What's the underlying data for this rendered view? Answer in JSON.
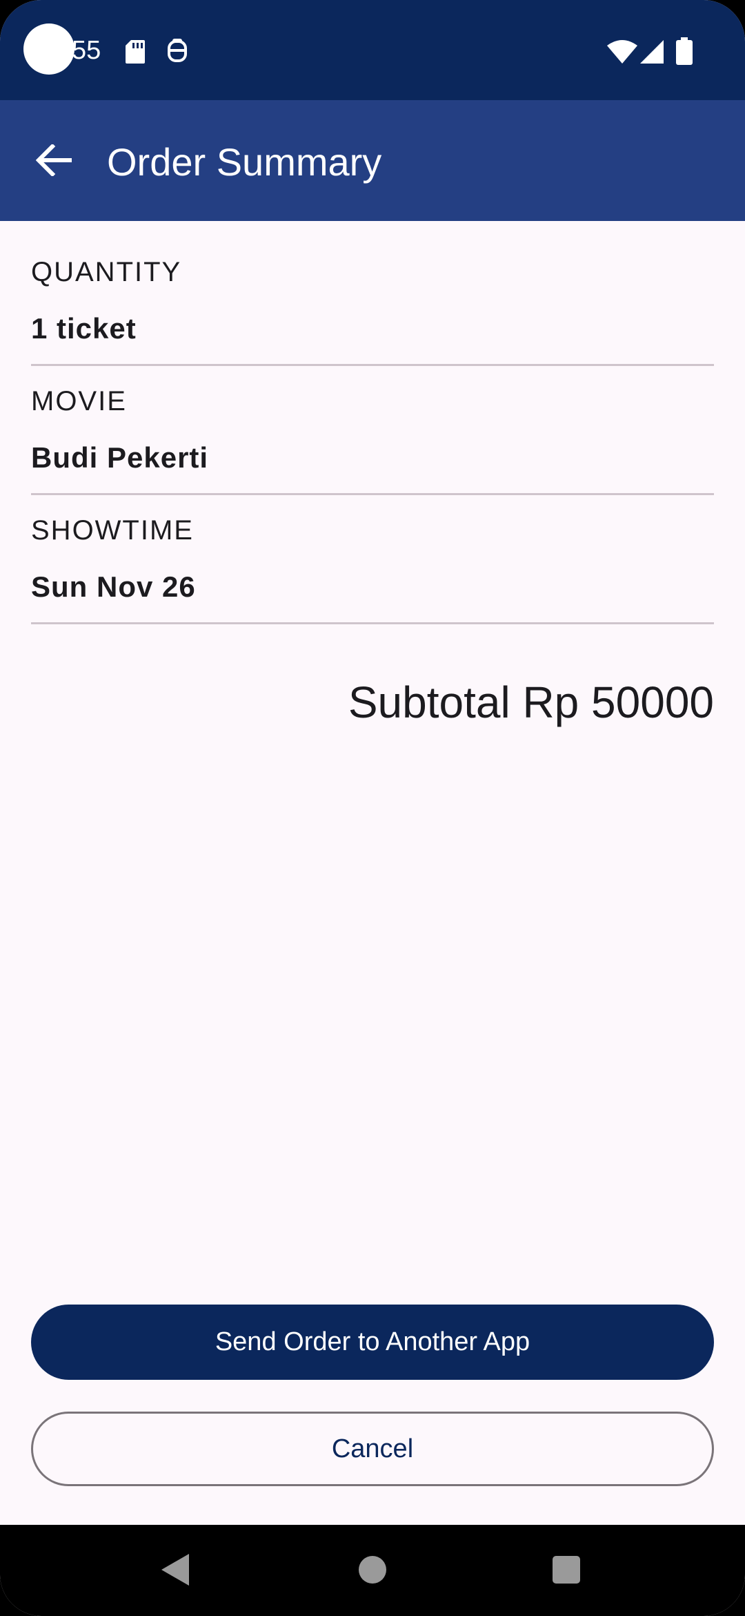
{
  "status_bar": {
    "time": "55",
    "icons": [
      "sd-card-icon",
      "face-icon",
      "wifi-icon",
      "signal-icon",
      "battery-icon"
    ]
  },
  "app_bar": {
    "back_icon": "arrow-left-icon",
    "title": "Order Summary"
  },
  "summary": {
    "fields": [
      {
        "label": "QUANTITY",
        "value": "1 ticket"
      },
      {
        "label": "MOVIE",
        "value": "Budi Pekerti"
      },
      {
        "label": "SHOWTIME",
        "value": "Sun Nov 26"
      }
    ],
    "subtotal": "Subtotal Rp 50000"
  },
  "actions": {
    "send_label": "Send Order to Another App",
    "cancel_label": "Cancel"
  },
  "nav_bar": {
    "icons": [
      "nav-back-icon",
      "nav-home-icon",
      "nav-recents-icon"
    ]
  },
  "colors": {
    "status_bar": "#0b275c",
    "app_bar": "#243f83",
    "background": "#fdf8fc",
    "primary": "#0b275c",
    "divider": "#cfc4cc"
  }
}
